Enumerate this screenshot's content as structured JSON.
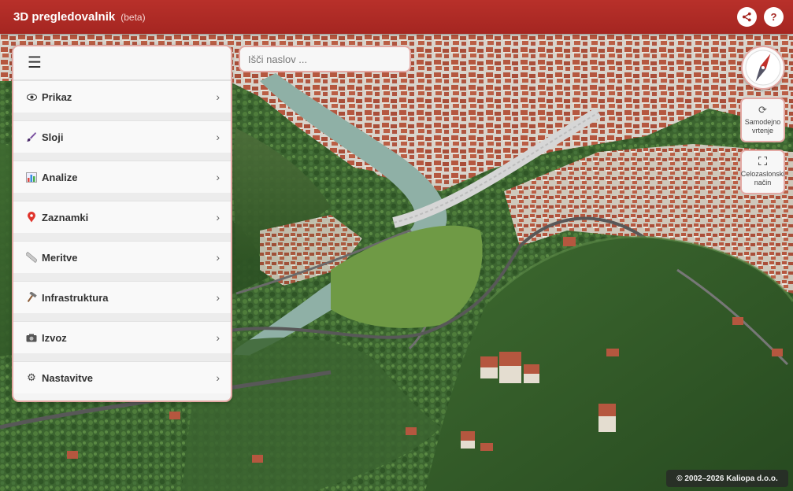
{
  "header": {
    "title": "3D pregledovalnik",
    "badge": "(beta)",
    "share_icon": "share-icon",
    "help_label": "?"
  },
  "sidebar": {
    "menu_icon": "hamburger-icon",
    "items": [
      {
        "icon": "eye-icon",
        "label": "Prikaz"
      },
      {
        "icon": "paintbrush-icon",
        "label": "Sloji"
      },
      {
        "icon": "bar-chart-icon",
        "label": "Analize"
      },
      {
        "icon": "pin-icon",
        "label": "Zaznamki"
      },
      {
        "icon": "ruler-icon",
        "label": "Meritve"
      },
      {
        "icon": "hammer-icon",
        "label": "Infrastruktura"
      },
      {
        "icon": "camera-icon",
        "label": "Izvoz"
      },
      {
        "icon": "gear-icon",
        "label": "Nastavitve"
      }
    ]
  },
  "search": {
    "placeholder": "Išči naslov ..."
  },
  "controls": {
    "compass_icon": "compass-icon",
    "rotate_label_1": "Samodejno",
    "rotate_label_2": "vrtenje",
    "fullscreen_label_1": "Celozaslonski",
    "fullscreen_label_2": "način"
  },
  "attribution": "© 2002–2026 Kaliopa d.o.o.",
  "colors": {
    "header": "#a52621",
    "accent_border": "#e3a9a4",
    "roof": "#b5573f",
    "forest": "#3f6a2e",
    "river": "#8fb0a6"
  }
}
